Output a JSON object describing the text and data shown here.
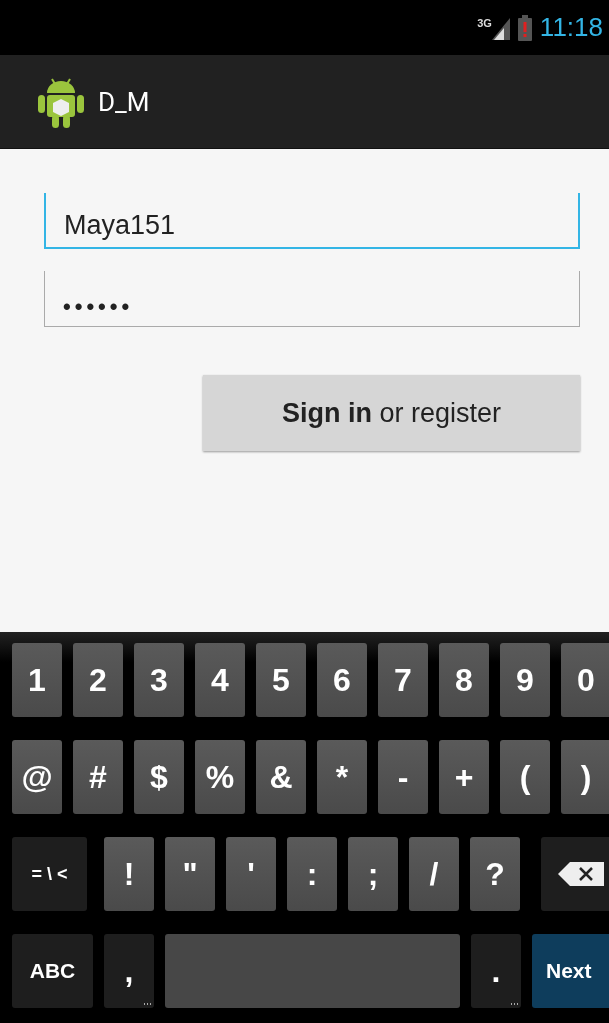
{
  "status_bar": {
    "network": "3G",
    "time": "11:18"
  },
  "action_bar": {
    "title": "D_M"
  },
  "form": {
    "fields": [
      {
        "kind": "text",
        "value": "Maya151",
        "focused": true
      },
      {
        "kind": "password",
        "value": "••••••",
        "focused": false
      }
    ],
    "button": "**Sign in** or register"
  },
  "keyboard": {
    "rows": [
      {
        "keys": [
          {
            "kind": "key",
            "label": "1"
          },
          {
            "kind": "key",
            "label": "2"
          },
          {
            "kind": "key",
            "label": "3"
          },
          {
            "kind": "key",
            "label": "4"
          },
          {
            "kind": "key",
            "label": "5"
          },
          {
            "kind": "key",
            "label": "6"
          },
          {
            "kind": "key",
            "label": "7"
          },
          {
            "kind": "key",
            "label": "8"
          },
          {
            "kind": "key",
            "label": "9"
          },
          {
            "kind": "key",
            "label": "0"
          }
        ]
      },
      {
        "keys": [
          {
            "kind": "key",
            "label": "@"
          },
          {
            "kind": "key",
            "label": "#"
          },
          {
            "kind": "key",
            "label": "$"
          },
          {
            "kind": "key",
            "label": "%"
          },
          {
            "kind": "key",
            "label": "&"
          },
          {
            "kind": "key",
            "label": "*"
          },
          {
            "kind": "key",
            "label": "-"
          },
          {
            "kind": "key",
            "label": "+"
          },
          {
            "kind": "key",
            "label": "("
          },
          {
            "kind": "key",
            "label": ")"
          }
        ]
      },
      {
        "keys": [
          {
            "kind": "symbols",
            "label": "= \\ <"
          },
          {
            "kind": "key",
            "label": "!"
          },
          {
            "kind": "key",
            "label": "\""
          },
          {
            "kind": "key",
            "label": "'"
          },
          {
            "kind": "key",
            "label": ":"
          },
          {
            "kind": "key",
            "label": ";"
          },
          {
            "kind": "key",
            "label": "/"
          },
          {
            "kind": "key",
            "label": "?"
          },
          {
            "kind": "delete"
          }
        ]
      },
      {
        "keys": [
          {
            "kind": "mode",
            "label": "ABC"
          },
          {
            "kind": "punct",
            "label": ","
          },
          {
            "kind": "space"
          },
          {
            "kind": "punct",
            "label": "."
          },
          {
            "kind": "action",
            "label": "Next"
          }
        ]
      }
    ]
  }
}
